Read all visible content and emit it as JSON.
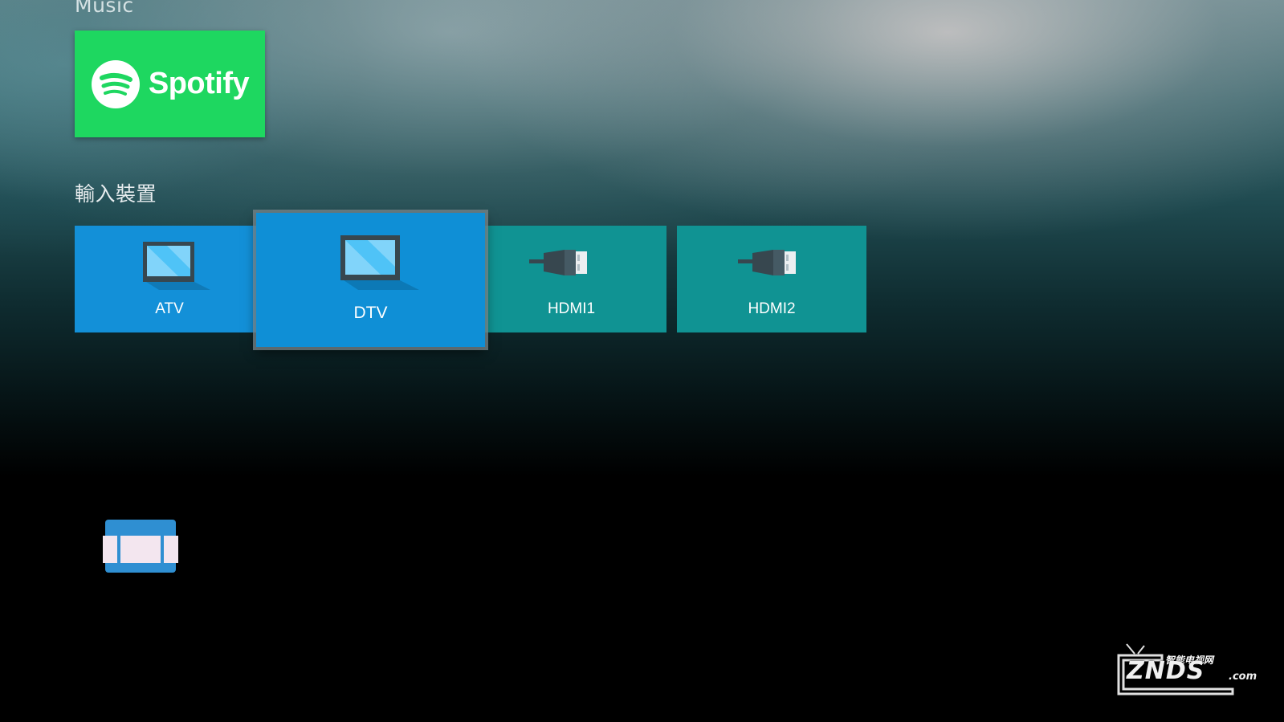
{
  "sections": {
    "music": {
      "title": "Music",
      "apps": [
        {
          "name": "Spotify",
          "brand_color": "#1ED760"
        }
      ]
    },
    "inputs": {
      "title": "輸入裝置",
      "items": [
        {
          "label": "ATV",
          "icon": "tv-icon",
          "color": "#1390D8",
          "selected": false
        },
        {
          "label": "DTV",
          "icon": "tv-icon",
          "color": "#0F8FD6",
          "selected": true
        },
        {
          "label": "HDMI1",
          "icon": "hdmi-cable-icon",
          "color": "#109393",
          "selected": false
        },
        {
          "label": "HDMI2",
          "icon": "hdmi-cable-icon",
          "color": "#109393",
          "selected": false
        }
      ]
    }
  },
  "settings": {
    "icon": "settings-panel-icon"
  },
  "watermark": {
    "chinese": "智能电视网",
    "brand": "ZNDS",
    "domain": ".com"
  }
}
